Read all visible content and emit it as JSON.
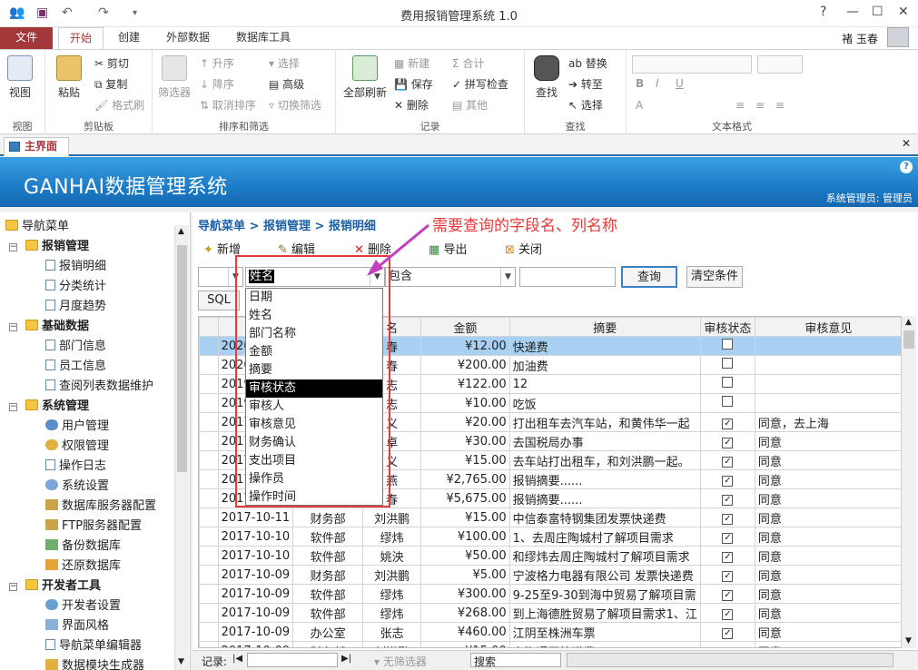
{
  "app": {
    "title": "费用报销管理系统 1.0"
  },
  "ribbon": {
    "tabs": [
      "文件",
      "开始",
      "创建",
      "外部数据",
      "数据库工具"
    ],
    "user": "褚 玉春",
    "groups": {
      "view": "视图",
      "clipboard": "剪贴板",
      "sort": "排序和筛选",
      "records": "记录",
      "find": "查找",
      "text": "文本格式"
    },
    "buttons": {
      "view": "视图",
      "paste": "粘贴",
      "cut": "剪切",
      "copy": "复制",
      "format": "格式刷",
      "filter": "筛选器",
      "asc": "升序",
      "desc": "降序",
      "clear_sort": "取消排序",
      "select": "选择",
      "advanced": "高级",
      "toggle": "切换筛选",
      "refresh": "全部刷新",
      "new": "新建",
      "save": "保存",
      "delete": "删除",
      "sum": "合计",
      "spell": "拼写检查",
      "other": "其他",
      "find": "查找",
      "replace": "替换",
      "goto": "转至",
      "select2": "选择"
    }
  },
  "doctab": "主界面",
  "banner": {
    "title": "GANHAI数据管理系统",
    "user": "系统管理员: 管理员"
  },
  "nav": {
    "root": "导航菜单",
    "items": [
      "报销管理",
      "报销明细",
      "分类统计",
      "月度趋势",
      "基础数据",
      "部门信息",
      "员工信息",
      "查阅列表数据维护",
      "系统管理",
      "用户管理",
      "权限管理",
      "操作日志",
      "系统设置",
      "数据库服务器配置",
      "FTP服务器配置",
      "备份数据库",
      "还原数据库",
      "开发者工具",
      "开发者设置",
      "界面风格",
      "导航菜单编辑器",
      "数据模块生成器"
    ]
  },
  "main": {
    "breadcrumb": "导航菜单 > 报销管理 > 报销明细",
    "toolbar": {
      "add": "新增",
      "edit": "编辑",
      "delete": "删除",
      "export": "导出",
      "close": "关闭"
    },
    "filter": {
      "field": "姓名",
      "op": "包含",
      "query": "查询",
      "clear": "清空条件",
      "sql": "SQL"
    },
    "columns": [
      "名",
      "金额",
      "摘要",
      "审核状态",
      "审核意见"
    ],
    "rows": [
      [
        "2020",
        "",
        "春",
        "¥12.00",
        "快递费",
        "0",
        ""
      ],
      [
        "2020",
        "",
        "春",
        "¥200.00",
        "加油费",
        "0",
        ""
      ],
      [
        "2019",
        "",
        "志",
        "¥122.00",
        "12",
        "0",
        ""
      ],
      [
        "2019",
        "",
        "志",
        "¥10.00",
        "吃饭",
        "0",
        ""
      ],
      [
        "2017",
        "",
        "义",
        "¥20.00",
        "打出租车去汽车站，和黄伟华一起",
        "1",
        "同意，去上海"
      ],
      [
        "2017",
        "",
        "卓",
        "¥30.00",
        "去国税局办事",
        "1",
        "同意"
      ],
      [
        "2017",
        "",
        "义",
        "¥15.00",
        "去车站打出租车，和刘洪鹏一起。",
        "1",
        "同意"
      ],
      [
        "2017",
        "",
        "燕",
        "¥2,765.00",
        "报销摘要......",
        "1",
        "同意"
      ],
      [
        "2017",
        "",
        "春",
        "¥5,675.00",
        "报销摘要......",
        "1",
        "同意"
      ],
      [
        "2017-10-11",
        "财务部",
        "刘洪鹏",
        "¥15.00",
        "中信泰富特钢集团发票快递费",
        "1",
        "同意"
      ],
      [
        "2017-10-10",
        "软件部",
        "缪炜",
        "¥100.00",
        "1、去周庄陶城村了解项目需求",
        "1",
        "同意"
      ],
      [
        "2017-10-10",
        "软件部",
        "姚泱",
        "¥50.00",
        "和缪炜去周庄陶城村了解项目需求",
        "1",
        "同意"
      ],
      [
        "2017-10-09",
        "财务部",
        "刘洪鹏",
        "¥5.00",
        "宁波格力电器有限公司 发票快递费",
        "1",
        "同意"
      ],
      [
        "2017-10-09",
        "软件部",
        "缪炜",
        "¥300.00",
        "9-25至9-30到海中贸易了解项目需",
        "1",
        "同意"
      ],
      [
        "2017-10-09",
        "软件部",
        "缪炜",
        "¥268.00",
        "到上海德胜贸易了解项目需求1、江",
        "1",
        "同意"
      ],
      [
        "2017-10-09",
        "办公室",
        "张志",
        "¥460.00",
        "江阴至株洲车票",
        "1",
        "同意"
      ],
      [
        "2017-10-09",
        "财务部",
        "刘洪鹏",
        "¥15.00",
        "上海通用快递费",
        "1",
        "同意"
      ]
    ],
    "status": {
      "record": "记录:",
      "nofilter": "无筛选器",
      "search": "搜索"
    }
  },
  "dropdown": {
    "options": [
      "日期",
      "姓名",
      "部门名称",
      "金额",
      "摘要",
      "审核状态",
      "审核人",
      "审核意见",
      "财务确认",
      "支出项目",
      "操作员",
      "操作时间"
    ],
    "active": "审核状态"
  },
  "annotation": "需要查询的字段名、列名称",
  "colors": {
    "accent": "#a4373a",
    "banner": "#1d7cc8",
    "annotation": "#e8393a"
  }
}
